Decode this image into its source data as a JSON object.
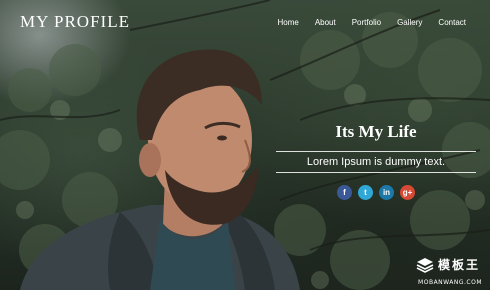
{
  "brand": {
    "title": "MY PROFILE"
  },
  "nav": {
    "items": [
      {
        "label": "Home"
      },
      {
        "label": "About"
      },
      {
        "label": "Portfolio"
      },
      {
        "label": "Gallery"
      },
      {
        "label": "Contact"
      }
    ]
  },
  "hero": {
    "headline": "Its My Life",
    "subline": "Lorem Ipsum is dummy text."
  },
  "social": [
    {
      "icon": "facebook-icon",
      "glyph": "f",
      "color": "#3b5998"
    },
    {
      "icon": "twitter-icon",
      "glyph": "t",
      "color": "#2fa8d8"
    },
    {
      "icon": "linkedin-icon",
      "glyph": "in",
      "color": "#1d78a8"
    },
    {
      "icon": "google-plus-icon",
      "glyph": "g+",
      "color": "#d64a35"
    }
  ],
  "watermark": {
    "name": "模板王",
    "url": "MOBANWANG.COM"
  }
}
